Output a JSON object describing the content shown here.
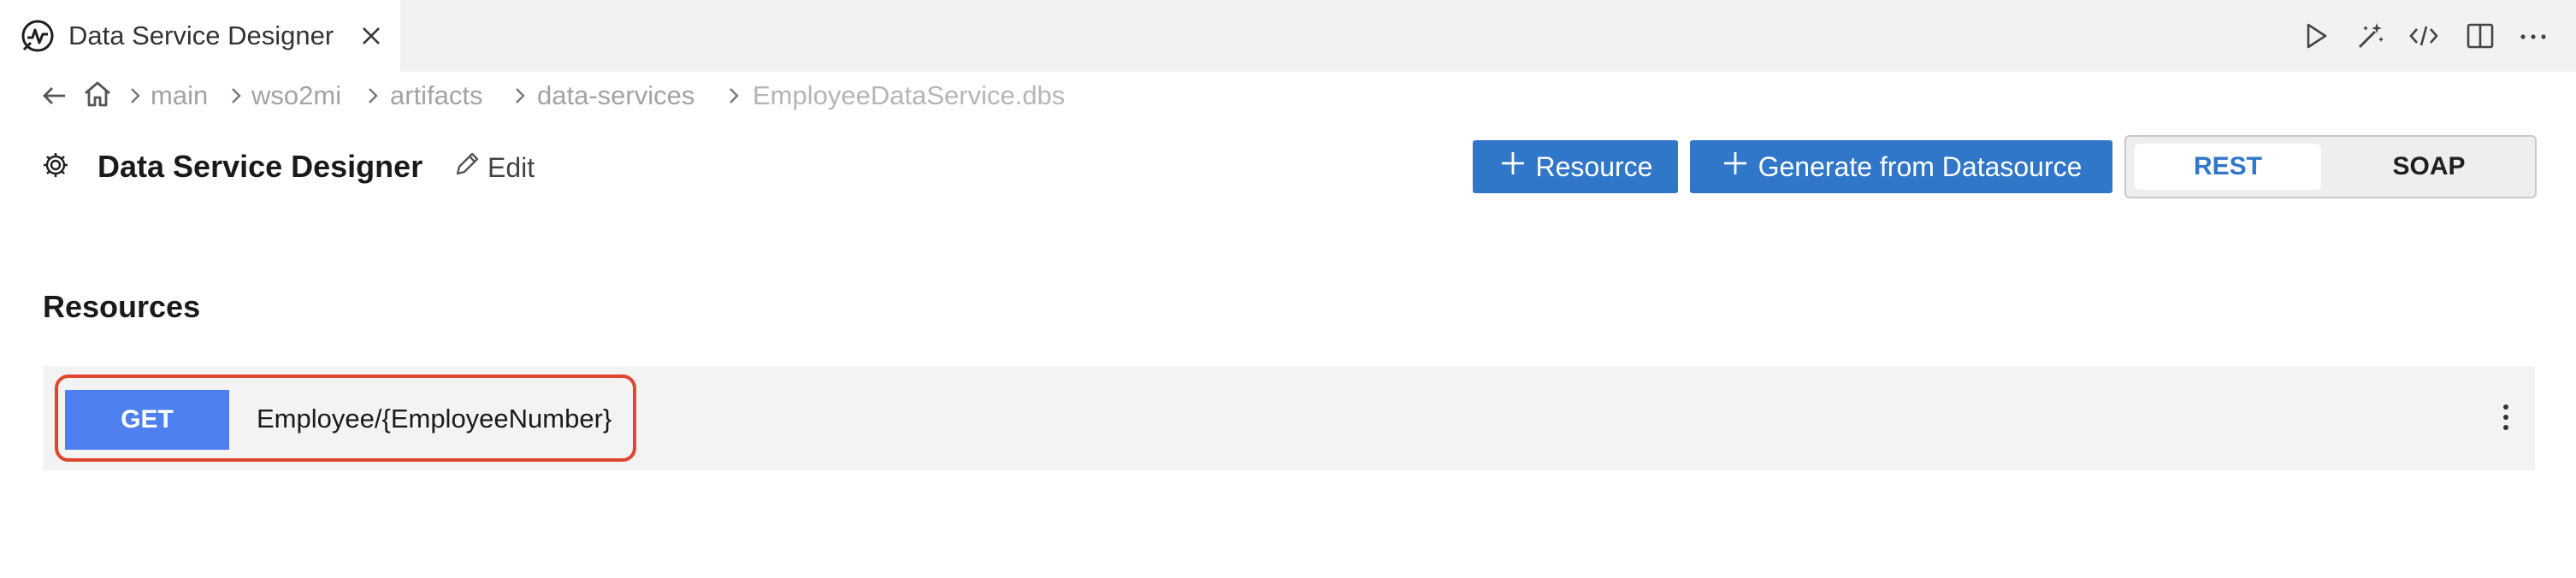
{
  "tab": {
    "title": "Data Service Designer"
  },
  "breadcrumb": {
    "items": [
      "main",
      "wso2mi",
      "artifacts",
      "data-services",
      "EmployeeDataService.dbs"
    ]
  },
  "header": {
    "title": "Data Service Designer",
    "edit_label": "Edit",
    "add_resource_label": "Resource",
    "generate_label": "Generate from Datasource",
    "mode_options": [
      "REST",
      "SOAP"
    ],
    "selected_mode": "REST"
  },
  "resources": {
    "section_title": "Resources",
    "items": [
      {
        "method": "GET",
        "path": "Employee/{EmployeeNumber}"
      }
    ]
  },
  "colors": {
    "primary_button": "#3077c9",
    "method_get": "#4f80f0",
    "highlight_border": "#e0452f",
    "breadcrumb_text": "#a3a3a3"
  },
  "icons": [
    "designer-tab-icon",
    "close-icon",
    "run-icon",
    "magic-wand-icon",
    "code-icon",
    "split-editor-icon",
    "more-icon",
    "back-arrow-icon",
    "home-icon",
    "chevron-right-icon",
    "gear-icon",
    "pencil-icon",
    "plus-icon",
    "kebab-menu-icon"
  ]
}
